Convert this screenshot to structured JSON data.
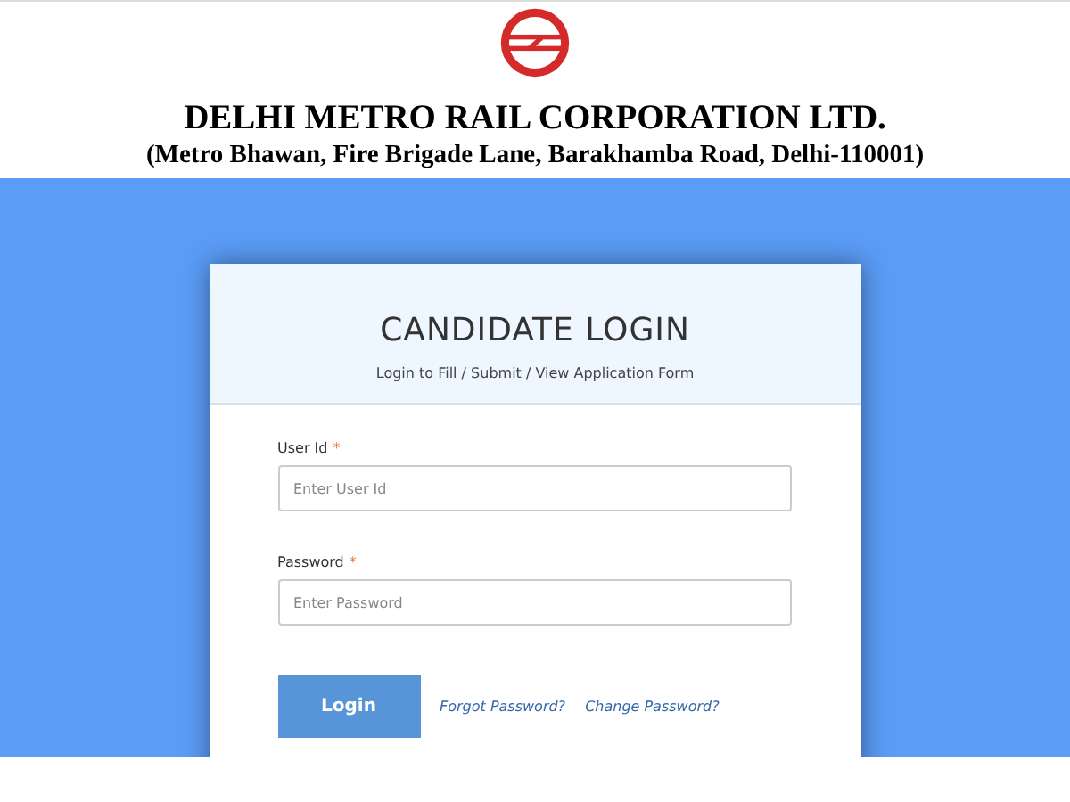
{
  "header": {
    "organization": "DELHI METRO RAIL CORPORATION LTD.",
    "address": "(Metro Bhawan, Fire Brigade Lane, Barakhamba Road, Delhi-110001)"
  },
  "card": {
    "title": "CANDIDATE LOGIN",
    "subtitle": "Login to Fill / Submit / View Application Form",
    "fields": [
      {
        "label": "User Id",
        "required_mark": "*",
        "placeholder": "Enter User Id"
      },
      {
        "label": "Password",
        "required_mark": "*",
        "placeholder": "Enter Password"
      }
    ],
    "button": "Login",
    "links": [
      "Forgot Password?",
      "Change Password?"
    ]
  }
}
